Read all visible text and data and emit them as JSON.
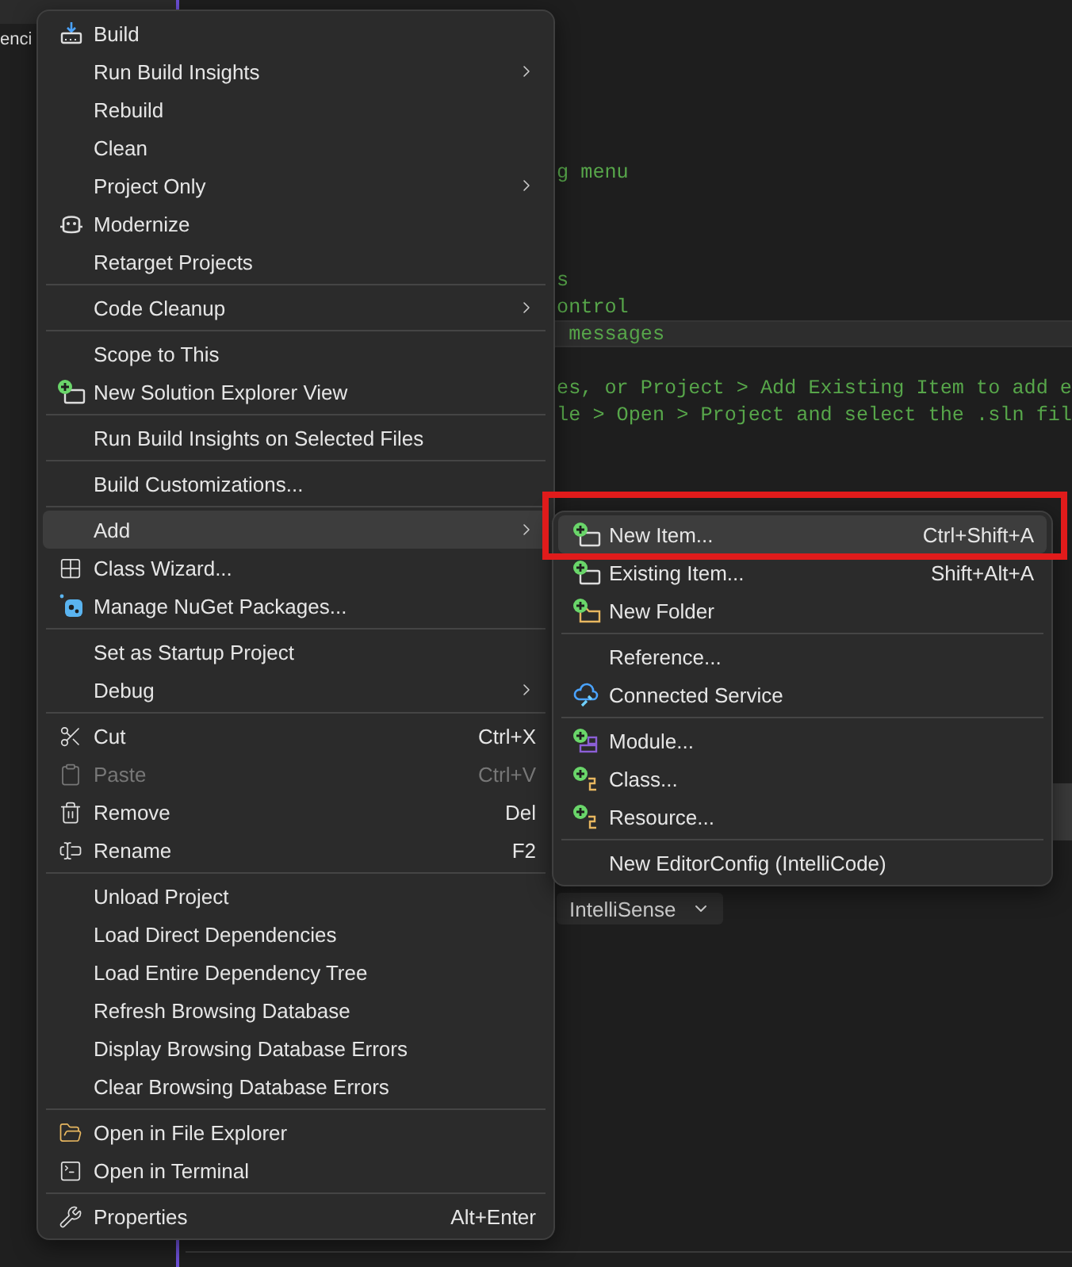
{
  "explorer": {
    "text": "enci"
  },
  "editor": {
    "lines": [
      {
        "text": "g menu",
        "current": false
      },
      {
        "text": "s",
        "current": false
      },
      {
        "text": "ontrol",
        "current": false
      },
      {
        "text": " messages",
        "current": true
      },
      {
        "text": "es, or Project > Add Existing Item to add e",
        "current": false
      },
      {
        "text": "le > Open > Project and select the .sln fil",
        "current": false
      }
    ],
    "dropdown": {
      "label": "IntelliSense"
    }
  },
  "context_menu": {
    "items": [
      {
        "kind": "item",
        "label": "Build",
        "selected": false,
        "disabled": false,
        "submenu": false
      },
      {
        "kind": "item",
        "label": "Run Build Insights",
        "selected": false,
        "disabled": false,
        "submenu": true
      },
      {
        "kind": "item",
        "label": "Rebuild",
        "selected": false,
        "disabled": false,
        "submenu": false
      },
      {
        "kind": "item",
        "label": "Clean",
        "selected": false,
        "disabled": false,
        "submenu": false
      },
      {
        "kind": "item",
        "label": "Project Only",
        "selected": false,
        "disabled": false,
        "submenu": true
      },
      {
        "kind": "item",
        "label": "Modernize",
        "selected": false,
        "disabled": false,
        "submenu": false
      },
      {
        "kind": "item",
        "label": "Retarget Projects",
        "selected": false,
        "disabled": false,
        "submenu": false
      },
      {
        "kind": "separator"
      },
      {
        "kind": "item",
        "label": "Code Cleanup",
        "selected": false,
        "disabled": false,
        "submenu": true
      },
      {
        "kind": "separator"
      },
      {
        "kind": "item",
        "label": "Scope to This",
        "selected": false,
        "disabled": false,
        "submenu": false
      },
      {
        "kind": "item",
        "label": "New Solution Explorer View",
        "selected": false,
        "disabled": false,
        "submenu": false
      },
      {
        "kind": "separator"
      },
      {
        "kind": "item",
        "label": "Run Build Insights on Selected Files",
        "selected": false,
        "disabled": false,
        "submenu": false
      },
      {
        "kind": "separator"
      },
      {
        "kind": "item",
        "label": "Build Customizations...",
        "selected": false,
        "disabled": false,
        "submenu": false
      },
      {
        "kind": "separator"
      },
      {
        "kind": "item",
        "label": "Add",
        "selected": true,
        "disabled": false,
        "submenu": true
      },
      {
        "kind": "item",
        "label": "Class Wizard...",
        "selected": false,
        "disabled": false,
        "submenu": false
      },
      {
        "kind": "item",
        "label": "Manage NuGet Packages...",
        "selected": false,
        "disabled": false,
        "submenu": false
      },
      {
        "kind": "separator"
      },
      {
        "kind": "item",
        "label": "Set as Startup Project",
        "selected": false,
        "disabled": false,
        "submenu": false
      },
      {
        "kind": "item",
        "label": "Debug",
        "selected": false,
        "disabled": false,
        "submenu": true
      },
      {
        "kind": "separator"
      },
      {
        "kind": "item",
        "label": "Cut",
        "shortcut": "Ctrl+X",
        "selected": false,
        "disabled": false,
        "submenu": false
      },
      {
        "kind": "item",
        "label": "Paste",
        "shortcut": "Ctrl+V",
        "selected": false,
        "disabled": true,
        "submenu": false
      },
      {
        "kind": "item",
        "label": "Remove",
        "shortcut": "Del",
        "selected": false,
        "disabled": false,
        "submenu": false
      },
      {
        "kind": "item",
        "label": "Rename",
        "shortcut": "F2",
        "selected": false,
        "disabled": false,
        "submenu": false
      },
      {
        "kind": "separator"
      },
      {
        "kind": "item",
        "label": "Unload Project",
        "selected": false,
        "disabled": false,
        "submenu": false
      },
      {
        "kind": "item",
        "label": "Load Direct Dependencies",
        "selected": false,
        "disabled": false,
        "submenu": false
      },
      {
        "kind": "item",
        "label": "Load Entire Dependency Tree",
        "selected": false,
        "disabled": false,
        "submenu": false
      },
      {
        "kind": "item",
        "label": "Refresh Browsing Database",
        "selected": false,
        "disabled": false,
        "submenu": false
      },
      {
        "kind": "item",
        "label": "Display Browsing Database Errors",
        "selected": false,
        "disabled": false,
        "submenu": false
      },
      {
        "kind": "item",
        "label": "Clear Browsing Database Errors",
        "selected": false,
        "disabled": false,
        "submenu": false
      },
      {
        "kind": "separator"
      },
      {
        "kind": "item",
        "label": "Open in File Explorer",
        "selected": false,
        "disabled": false,
        "submenu": false
      },
      {
        "kind": "item",
        "label": "Open in Terminal",
        "selected": false,
        "disabled": false,
        "submenu": false
      },
      {
        "kind": "separator"
      },
      {
        "kind": "item",
        "label": "Properties",
        "shortcut": "Alt+Enter",
        "selected": false,
        "disabled": false,
        "submenu": false
      }
    ]
  },
  "add_submenu": {
    "items": [
      {
        "kind": "item",
        "label": "New Item...",
        "shortcut": "Ctrl+Shift+A",
        "selected": true
      },
      {
        "kind": "item",
        "label": "Existing Item...",
        "shortcut": "Shift+Alt+A",
        "selected": false
      },
      {
        "kind": "item",
        "label": "New Folder",
        "selected": false
      },
      {
        "kind": "separator"
      },
      {
        "kind": "item",
        "label": "Reference...",
        "selected": false
      },
      {
        "kind": "item",
        "label": "Connected Service",
        "selected": false
      },
      {
        "kind": "separator"
      },
      {
        "kind": "item",
        "label": "Module...",
        "selected": false
      },
      {
        "kind": "item",
        "label": "Class...",
        "selected": false
      },
      {
        "kind": "item",
        "label": "Resource...",
        "selected": false
      },
      {
        "kind": "separator"
      },
      {
        "kind": "item",
        "label": "New EditorConfig (IntelliCode)",
        "selected": false
      }
    ]
  }
}
